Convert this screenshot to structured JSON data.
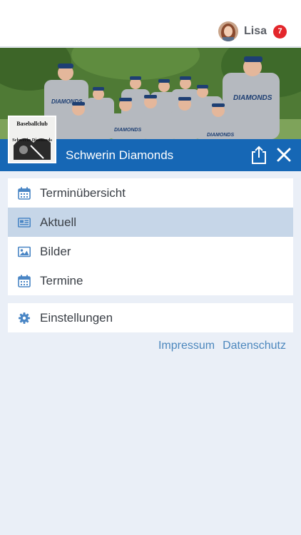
{
  "header": {
    "user_name": "Lisa",
    "notification_count": "7"
  },
  "club": {
    "name": "Schwerin Diamonds",
    "logo_text_line1": "Baseballclub",
    "logo_text_line2": "Schwerin Diamonds",
    "jersey_text": "DIAMONDS"
  },
  "menu": {
    "items": [
      {
        "label": "Terminübersicht",
        "icon": "calendar-icon",
        "active": false
      },
      {
        "label": "Aktuell",
        "icon": "news-icon",
        "active": true
      },
      {
        "label": "Bilder",
        "icon": "image-icon",
        "active": false
      },
      {
        "label": "Termine",
        "icon": "calendar-icon",
        "active": false
      }
    ],
    "settings": {
      "label": "Einstellungen",
      "icon": "gear-icon"
    }
  },
  "footer": {
    "impressum": "Impressum",
    "datenschutz": "Datenschutz"
  },
  "colors": {
    "accent": "#1667b5",
    "active_row": "#c6d6e8",
    "badge": "#e3262b",
    "link": "#4c87bd",
    "background": "#eaeff7"
  }
}
